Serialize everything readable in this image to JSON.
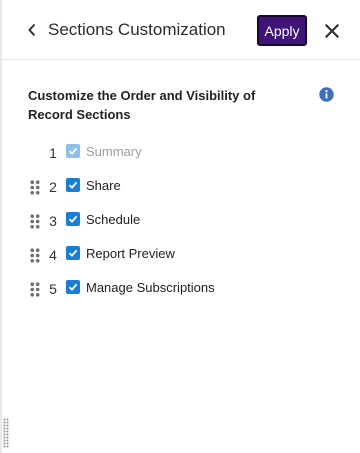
{
  "header": {
    "title": "Sections Customization",
    "apply_label": "Apply",
    "back_icon": "chevron-left-icon",
    "close_icon": "close-icon"
  },
  "content": {
    "heading": "Customize the Order and Visibility of Record Sections",
    "info_icon": "info-icon"
  },
  "sections": [
    {
      "number": "1",
      "label": "Summary",
      "checked": true,
      "disabled": true,
      "draggable": false
    },
    {
      "number": "2",
      "label": "Share",
      "checked": true,
      "disabled": false,
      "draggable": true
    },
    {
      "number": "3",
      "label": "Schedule",
      "checked": true,
      "disabled": false,
      "draggable": true
    },
    {
      "number": "4",
      "label": "Report Preview",
      "checked": true,
      "disabled": false,
      "draggable": true
    },
    {
      "number": "5",
      "label": "Manage Subscriptions",
      "checked": true,
      "disabled": false,
      "draggable": true
    }
  ],
  "colors": {
    "apply_button": "#3e1477",
    "checkbox": "#1a7fd4",
    "checkbox_disabled": "#8fc0e8",
    "info_icon": "#3b6fbf"
  }
}
